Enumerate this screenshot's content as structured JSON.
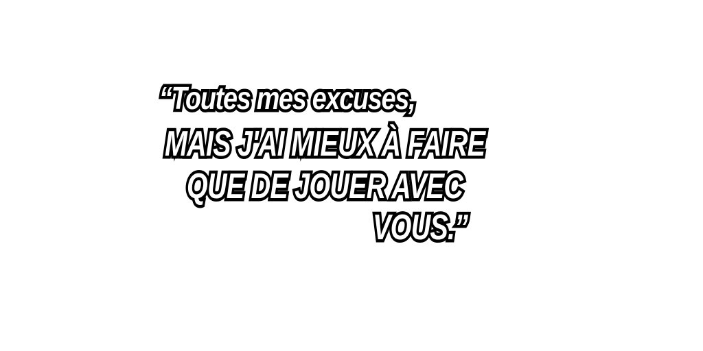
{
  "quote": {
    "line1": "“Toutes mes excuses,",
    "line2": "MAIS J'AI MIEUX À FAIRE",
    "line3": "QUE DE JOUER AVEC",
    "line4": "VOUS.”"
  }
}
